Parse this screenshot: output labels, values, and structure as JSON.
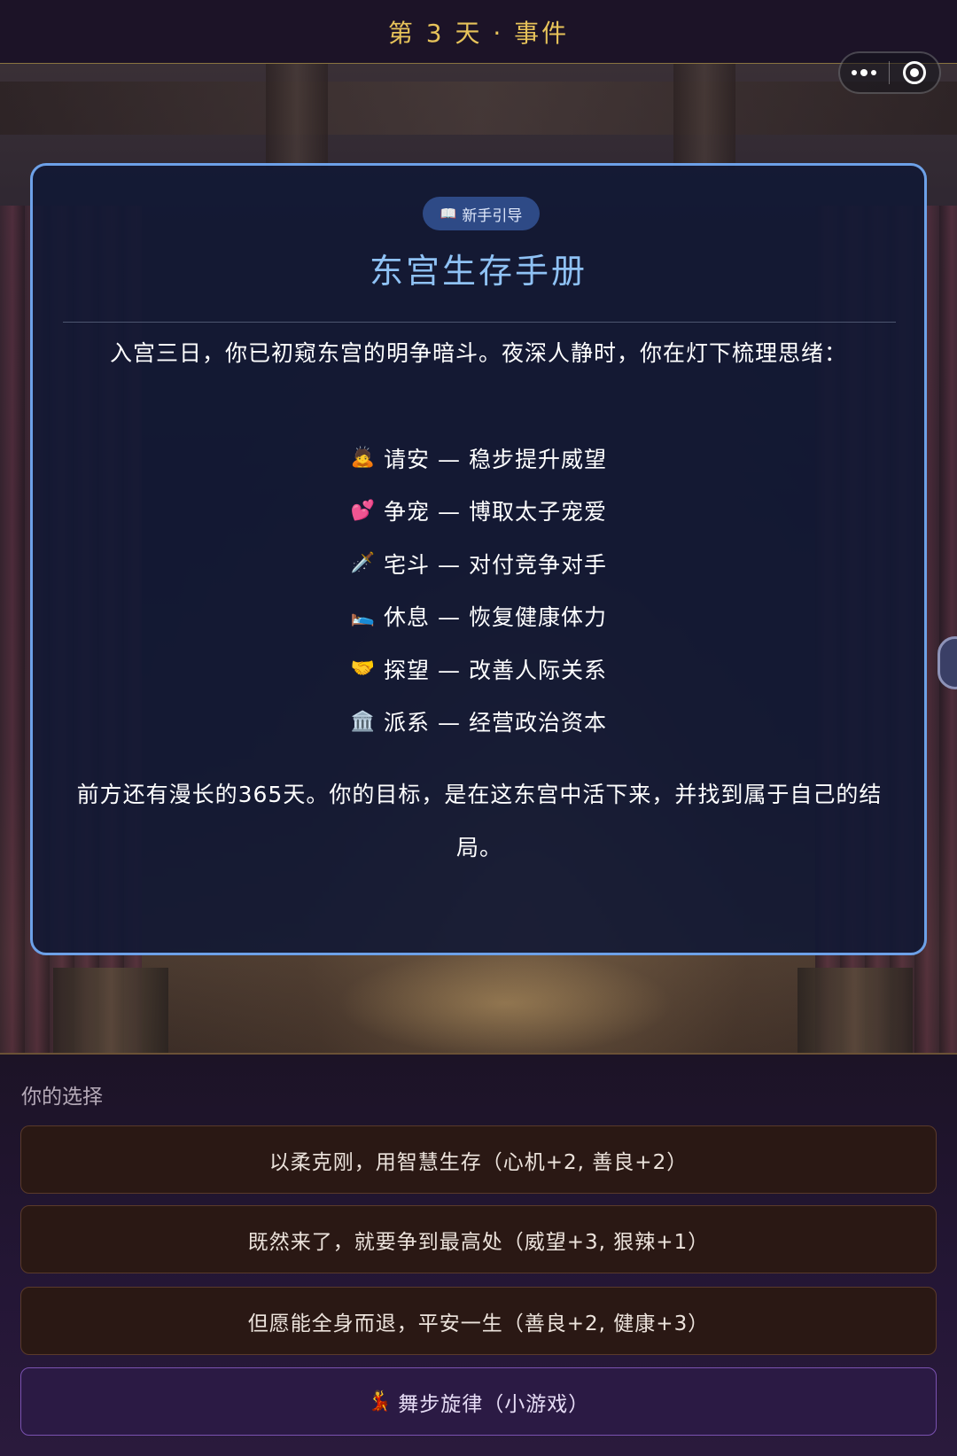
{
  "header": {
    "title": "第 3 天 · 事件"
  },
  "capsule": {
    "more_icon": "more-dots-icon",
    "close_icon": "target-circle-icon"
  },
  "card": {
    "badge": {
      "icon": "📖",
      "label": "新手引导"
    },
    "title": "东宫生存手册",
    "intro": "入宫三日，你已初窥东宫的明争暗斗。夜深人静时，你在灯下梳理思绪：",
    "items": [
      {
        "emoji": "🙇",
        "text": "请安 — 稳步提升威望"
      },
      {
        "emoji": "💕",
        "text": "争宠 — 博取太子宠爱"
      },
      {
        "emoji": "🗡️",
        "text": "宅斗 — 对付竞争对手"
      },
      {
        "emoji": "🛌",
        "text": "休息 — 恢复健康体力"
      },
      {
        "emoji": "🤝",
        "text": "探望 — 改善人际关系"
      },
      {
        "emoji": "🏛️",
        "text": "派系 — 经营政治资本"
      }
    ],
    "ending": "前方还有漫长的365天。你的目标，是在这东宫中活下来，并找到属于自己的结局。"
  },
  "choices": {
    "label": "你的选择",
    "options": [
      {
        "label": "以柔克刚，用智慧生存（心机+2, 善良+2）"
      },
      {
        "label": "既然来了，就要争到最高处（威望+3, 狠辣+1）"
      },
      {
        "label": "但愿能全身而退，平安一生（善良+2, 健康+3）"
      }
    ],
    "minigame": {
      "icon": "💃",
      "label": "舞步旋律（小游戏）"
    }
  },
  "colors": {
    "header_gold": "#e7c35a",
    "card_border": "#6da1e8",
    "card_title": "#8fc2f5",
    "minigame_border": "#7a52b0"
  }
}
